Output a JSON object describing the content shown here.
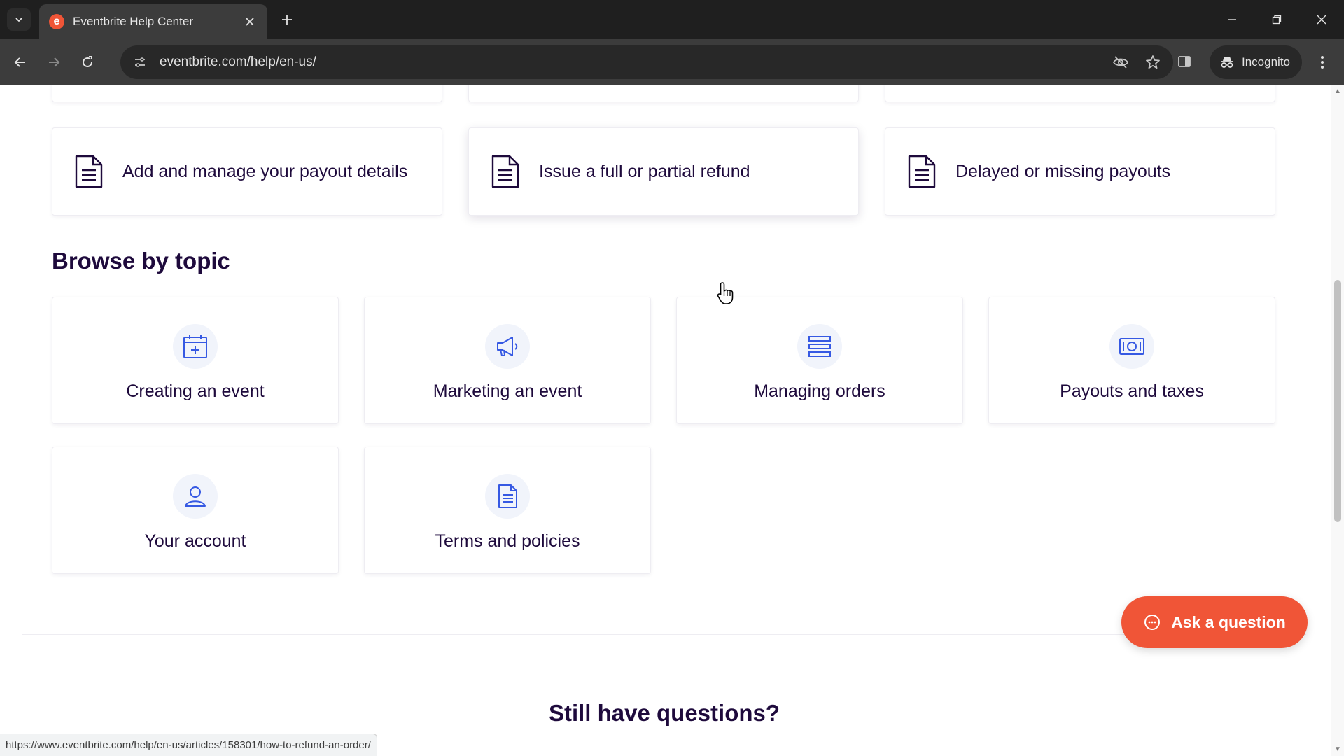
{
  "browser": {
    "tab_title": "Eventbrite Help Center",
    "favicon_letter": "e",
    "url": "eventbrite.com/help/en-us/",
    "incognito_label": "Incognito",
    "status_url": "https://www.eventbrite.com/help/en-us/articles/158301/how-to-refund-an-order/"
  },
  "articles": [
    {
      "title": "Add and manage your payout details",
      "icon": "document-icon"
    },
    {
      "title": "Issue a full or partial refund",
      "icon": "document-icon"
    },
    {
      "title": "Delayed or missing payouts",
      "icon": "document-icon"
    }
  ],
  "browse": {
    "title": "Browse by topic",
    "topics": [
      {
        "label": "Creating an event",
        "icon": "calendar-plus-icon"
      },
      {
        "label": "Marketing an event",
        "icon": "megaphone-icon"
      },
      {
        "label": "Managing orders",
        "icon": "list-icon"
      },
      {
        "label": "Payouts and taxes",
        "icon": "money-icon"
      },
      {
        "label": "Your account",
        "icon": "user-icon"
      },
      {
        "label": "Terms and policies",
        "icon": "document-icon"
      }
    ]
  },
  "footer": {
    "still_title": "Still have questions?",
    "ask_label": "Ask a question"
  },
  "colors": {
    "brand": "#f05537",
    "text": "#1e0a3c",
    "icon_accent": "#3659e3"
  }
}
